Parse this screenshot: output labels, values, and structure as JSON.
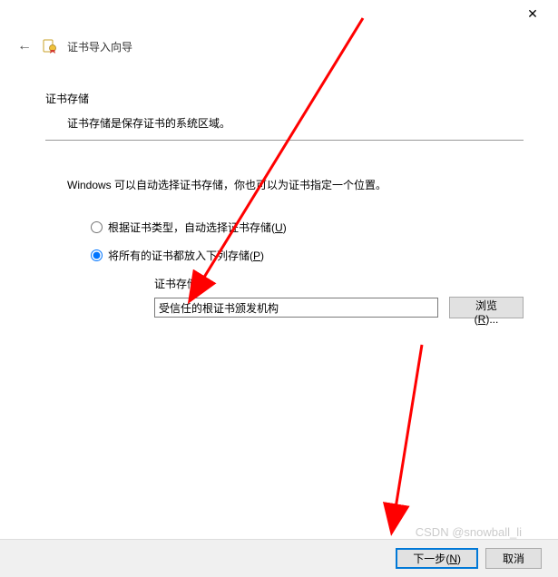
{
  "window": {
    "close_glyph": "✕"
  },
  "header": {
    "back_glyph": "←",
    "title": "证书导入向导"
  },
  "section": {
    "title": "证书存储",
    "description": "证书存储是保存证书的系统区域。"
  },
  "instruction": "Windows 可以自动选择证书存储，你也可以为证书指定一个位置。",
  "radios": {
    "auto": {
      "label": "根据证书类型，自动选择证书存储",
      "mnemonic": "U"
    },
    "manual": {
      "label": "将所有的证书都放入下列存储",
      "mnemonic": "P"
    }
  },
  "store": {
    "label": "证书存储:",
    "value": "受信任的根证书颁发机构",
    "browse": {
      "label": "浏览",
      "mnemonic": "R"
    }
  },
  "footer": {
    "next": {
      "label": "下一步",
      "mnemonic": "N"
    },
    "cancel": {
      "label": "取消"
    }
  },
  "watermark": "CSDN @snowball_li",
  "annotations": {
    "arrow_color": "#ff0000"
  }
}
